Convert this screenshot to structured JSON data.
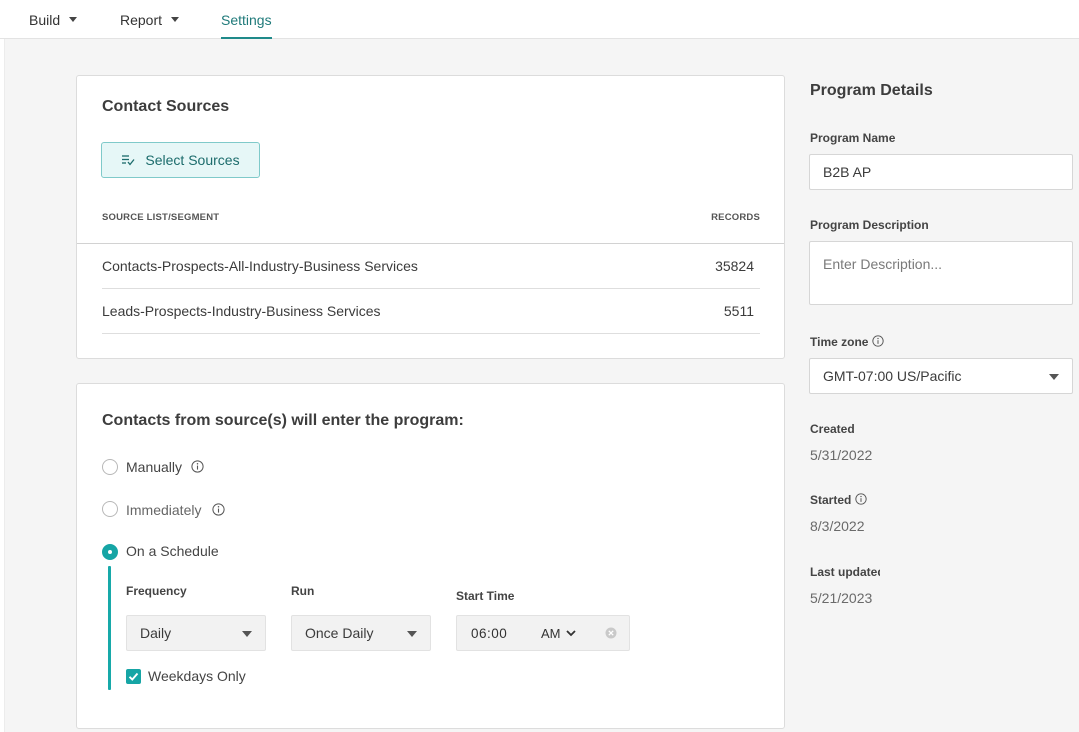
{
  "nav": {
    "tabs": [
      {
        "label": "Build",
        "has_caret": true
      },
      {
        "label": "Report",
        "has_caret": true
      },
      {
        "label": "Settings",
        "has_caret": false,
        "active": true
      }
    ]
  },
  "contact_sources": {
    "title": "Contact Sources",
    "select_button_label": "Select Sources",
    "table": {
      "columns": [
        "SOURCE LIST/SEGMENT",
        "RECORDS"
      ],
      "rows": [
        {
          "source": "Contacts-Prospects-All-Industry-Business Services",
          "records": "35824"
        },
        {
          "source": "Leads-Prospects-Industry-Business Services",
          "records": "5511"
        }
      ]
    }
  },
  "entry": {
    "title": "Contacts from source(s) will enter the program:",
    "options": [
      {
        "label": "Manually",
        "checked": false,
        "info": true
      },
      {
        "label": "Immediately",
        "checked": false,
        "info": true
      },
      {
        "label": "On a Schedule",
        "checked": true,
        "info": false
      }
    ],
    "schedule": {
      "frequency_label": "Frequency",
      "frequency_value": "Daily",
      "run_label": "Run",
      "run_value": "Once Daily",
      "start_time_label": "Start Time",
      "start_time_value": "06:00",
      "ampm_value": "AM",
      "weekdays_label": "Weekdays Only",
      "weekdays_checked": true
    }
  },
  "program_details": {
    "title": "Program Details",
    "name_label": "Program Name",
    "name_value": "B2B AP",
    "description_label": "Program Description",
    "description_placeholder": "Enter Description...",
    "timezone_label": "Time zone",
    "timezone_value": "GMT-07:00 US/Pacific",
    "created_label": "Created",
    "created_value": "5/31/2022",
    "started_label": "Started",
    "started_value": "8/3/2022",
    "updated_label": "Last updated",
    "updated_value": "5/21/2023"
  },
  "colors": {
    "accent": "#16a5a5",
    "accent_text": "#1f7a7a",
    "button_bg": "#e6f7f7"
  }
}
